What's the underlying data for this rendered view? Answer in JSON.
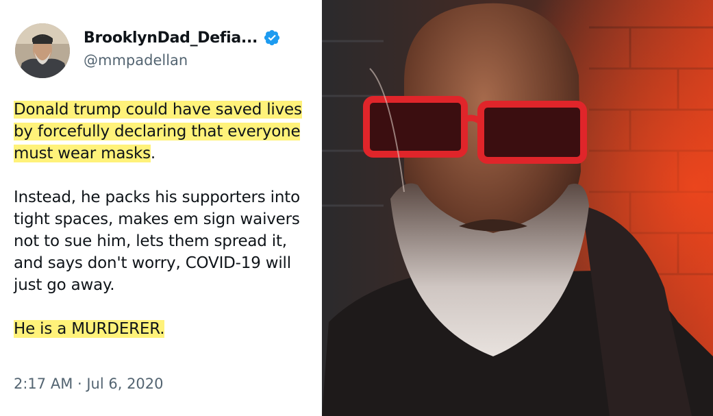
{
  "tweet": {
    "display_name": "BrooklynDad_Defia...",
    "handle": "@mmpadellan",
    "paragraph1_highlighted": "Donald trump could have saved lives by forcefully declaring that everyone must wear masks",
    "paragraph1_tail": ".",
    "paragraph2": "Instead, he packs his supporters into tight spaces, makes em sign waivers not to sue him, lets them spread it, and says don't worry, COVID-19 will just go away.",
    "paragraph3_highlighted": "He is a MURDERER.",
    "timestamp": "2:17 AM · Jul 6, 2020"
  },
  "icons": {
    "verified": "verified-badge-icon",
    "verified_color": "#1d9bf0"
  },
  "colors": {
    "highlight": "#fff27a",
    "text": "#0f1419",
    "muted": "#536471"
  }
}
